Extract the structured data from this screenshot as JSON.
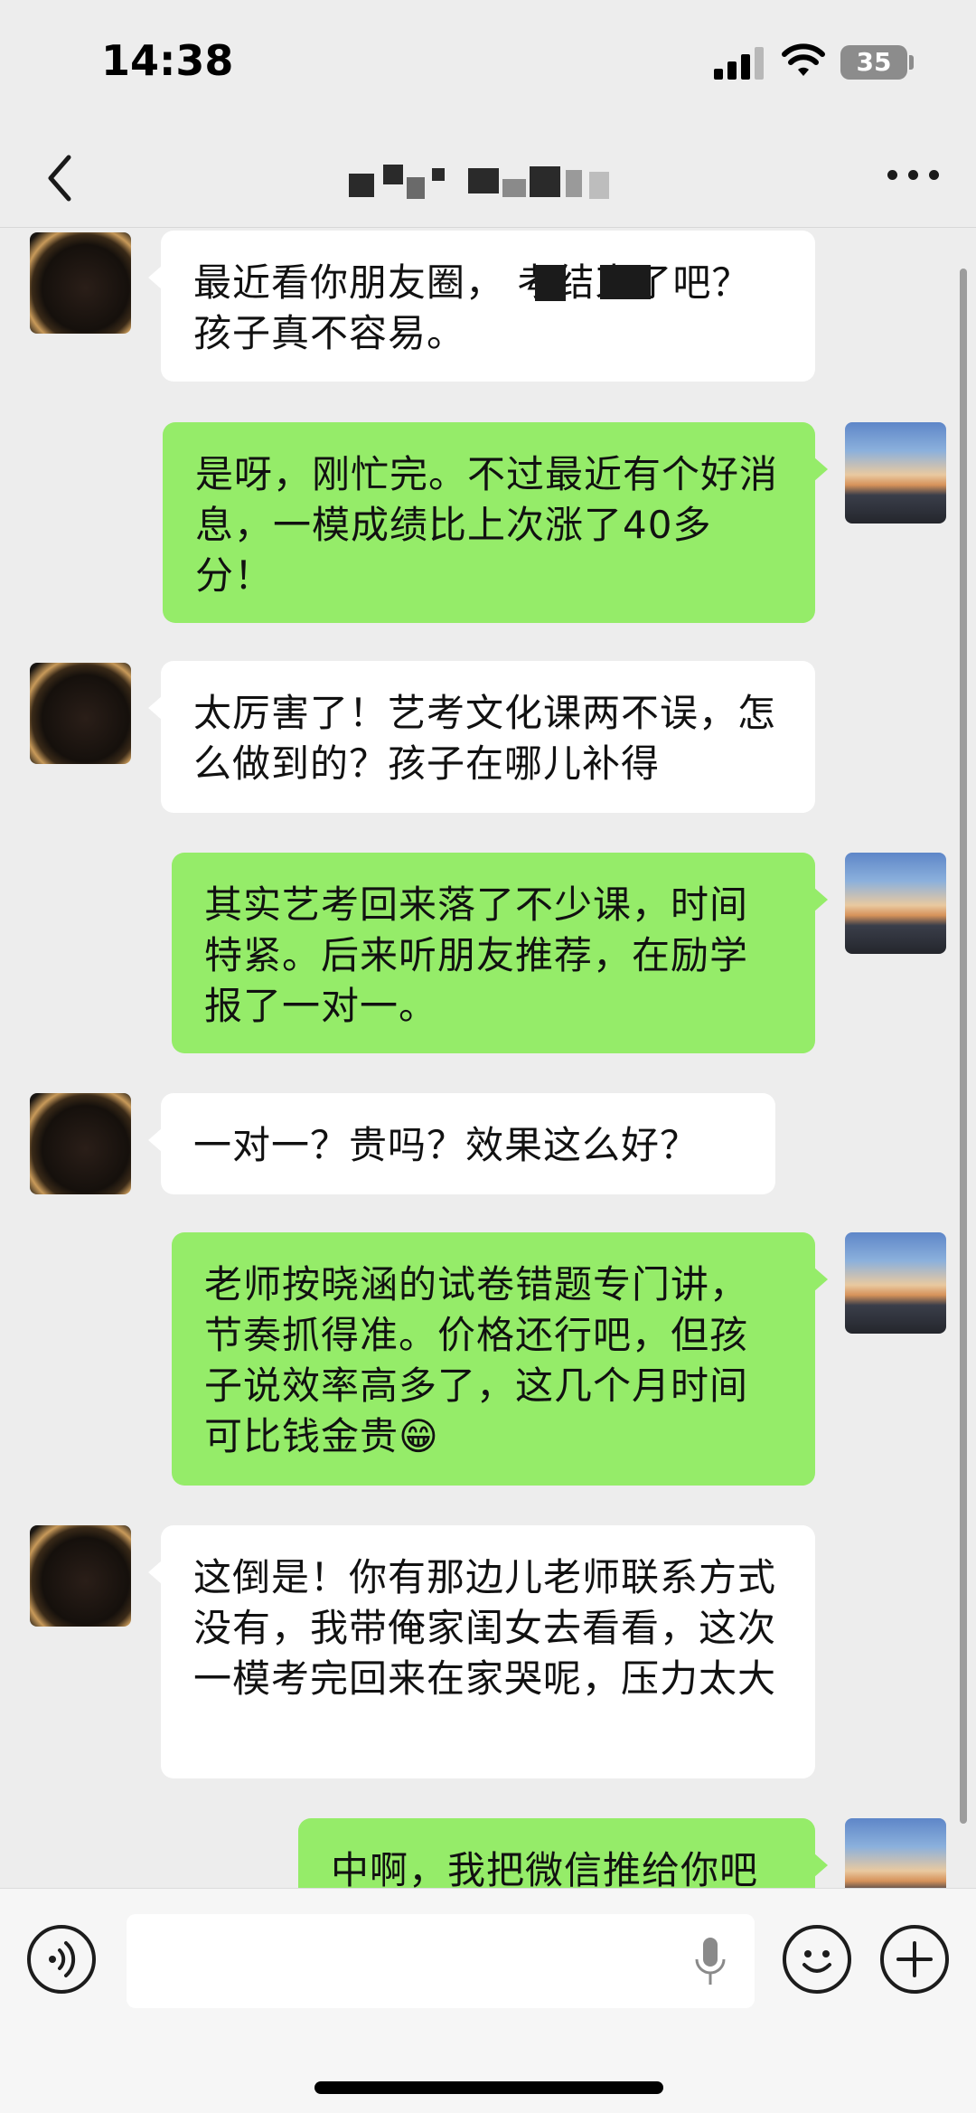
{
  "status_bar": {
    "time": "14:38",
    "battery": "35"
  },
  "nav": {
    "title": ""
  },
  "messages": [
    {
      "side": "peer",
      "text": "最近看你朋友圈，      考结束了吧？孩子真不容易。"
    },
    {
      "side": "self",
      "text": "是呀，刚忙完。不过最近有个好消息，一模成绩比上次涨了40多分！"
    },
    {
      "side": "peer",
      "text": "太厉害了！艺考文化课两不误，怎么做到的？孩子在哪儿补得"
    },
    {
      "side": "self",
      "text": "其实艺考回来落了不少课，时间特紧。后来听朋友推荐，在励学报了一对一。"
    },
    {
      "side": "peer",
      "text": "一对一？贵吗？效果这么好？"
    },
    {
      "side": "self",
      "text": "老师按晓涵的试卷错题专门讲，节奏抓得准。价格还行吧，但孩子说效率高多了，这几个月时间可比钱金贵😁"
    },
    {
      "side": "peer",
      "text": "这倒是！你有那边儿老师联系方式没有，我带俺家闺女去看看，这次一模考完回来在家哭呢，压力太大"
    },
    {
      "side": "self",
      "text": "中啊，我把微信推给你吧"
    }
  ],
  "input": {
    "placeholder": ""
  },
  "icons": [
    "back-icon",
    "more-icon",
    "voice-icon",
    "mic-icon",
    "emoji-icon",
    "plus-icon"
  ],
  "colors": {
    "self_bubble": "#95ec69",
    "peer_bubble": "#ffffff",
    "background": "#ededed"
  }
}
